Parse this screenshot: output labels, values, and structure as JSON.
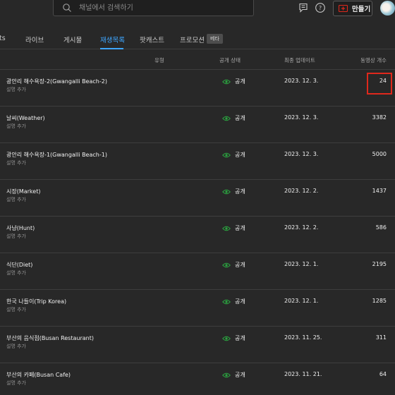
{
  "search": {
    "placeholder": "채널에서 검색하기"
  },
  "header": {
    "create_label": "만들기"
  },
  "tabs": [
    {
      "label": "ts"
    },
    {
      "label": "라이브"
    },
    {
      "label": "게시물"
    },
    {
      "label": "재생목록"
    },
    {
      "label": "팟캐스트"
    },
    {
      "label": "프로모션"
    }
  ],
  "beta_label": "베타",
  "table": {
    "columns": {
      "type": "유형",
      "visibility": "공개 상태",
      "updated": "최종 업데이트",
      "count": "동영상 개수"
    },
    "rows": [
      {
        "title": "광안리 해수욕장-2(Gwangalli Beach-2)",
        "desc": "설명 추가",
        "visibility": "공개",
        "date": "2023. 12. 3.",
        "count": "24"
      },
      {
        "title": "날씨(Weather)",
        "desc": "설명 추가",
        "visibility": "공개",
        "date": "2023. 12. 3.",
        "count": "3382"
      },
      {
        "title": "광안리 해수욕장-1(Gwangalli Beach-1)",
        "desc": "설명 추가",
        "visibility": "공개",
        "date": "2023. 12. 3.",
        "count": "5000"
      },
      {
        "title": "시장(Market)",
        "desc": "설명 추가",
        "visibility": "공개",
        "date": "2023. 12. 2.",
        "count": "1437"
      },
      {
        "title": "사냥(Hunt)",
        "desc": "설명 추가",
        "visibility": "공개",
        "date": "2023. 12. 2.",
        "count": "586"
      },
      {
        "title": "식단(Diet)",
        "desc": "설명 추가",
        "visibility": "공개",
        "date": "2023. 12. 1.",
        "count": "2195"
      },
      {
        "title": "한국 나들이(Trip Korea)",
        "desc": "설명 추가",
        "visibility": "공개",
        "date": "2023. 12. 1.",
        "count": "1285"
      },
      {
        "title": "부산의 음식점(Busan Restaurant)",
        "desc": "설명 추가",
        "visibility": "공개",
        "date": "2023. 11. 25.",
        "count": "311"
      },
      {
        "title": "부산의 카페(Busan Cafe)",
        "desc": "설명 추가",
        "visibility": "공개",
        "date": "2023. 11. 21.",
        "count": "64"
      }
    ]
  },
  "colors": {
    "accent": "#3ea6ff",
    "public_icon": "#2ba640",
    "highlight": "#e0281c",
    "create_icon": "#e0281c"
  },
  "icons": {
    "search": "search-icon",
    "feedback": "feedback-icon",
    "help": "help-icon",
    "create": "create-video-icon",
    "visibility": "eye-icon"
  }
}
